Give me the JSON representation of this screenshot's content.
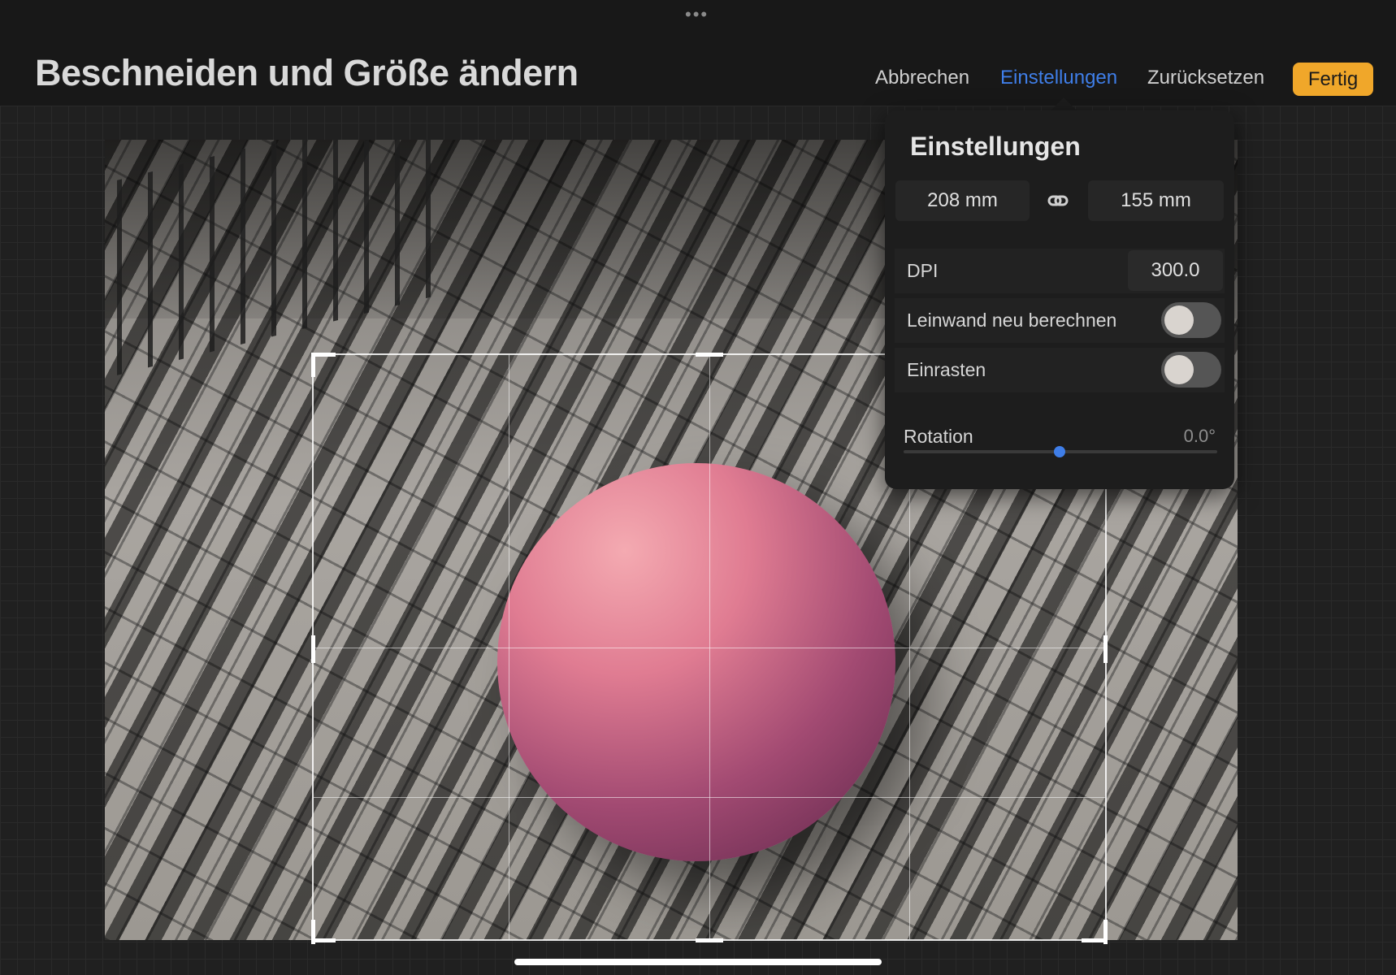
{
  "header": {
    "more": "•••",
    "title": "Beschneiden und Größe ändern",
    "cancel": "Abbrechen",
    "settings": "Einstellungen",
    "reset": "Zurücksetzen",
    "done": "Fertig"
  },
  "settings_panel": {
    "title": "Einstellungen",
    "width": "208 mm",
    "height": "155 mm",
    "dpi_label": "DPI",
    "dpi_value": "300.0",
    "resample_label": "Leinwand neu berechnen",
    "resample_on": false,
    "snap_label": "Einrasten",
    "snap_on": false,
    "rotation_label": "Rotation",
    "rotation_value": "0.0°",
    "rotation_fraction": 0.5
  },
  "colors": {
    "accent_blue": "#3f7ee8",
    "done_orange": "#f0a72a"
  },
  "icons": {
    "link": "link-icon",
    "more": "more-dots-icon"
  }
}
